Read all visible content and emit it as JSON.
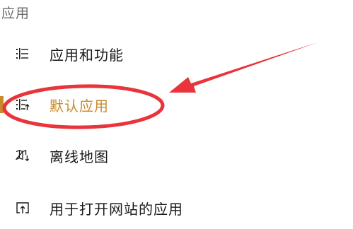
{
  "section": {
    "title": "应用"
  },
  "nav": {
    "items": [
      {
        "label": "应用和功能",
        "icon": "list-icon"
      },
      {
        "label": "默认应用",
        "icon": "default-apps-icon",
        "selected": true
      },
      {
        "label": "离线地图",
        "icon": "offline-map-icon"
      },
      {
        "label": "用于打开网站的应用",
        "icon": "open-website-icon"
      }
    ]
  },
  "colors": {
    "accent": "#c88a2c",
    "annotation": "#e8343a",
    "text": "#1a1a1a",
    "title": "#6b6b6b"
  }
}
